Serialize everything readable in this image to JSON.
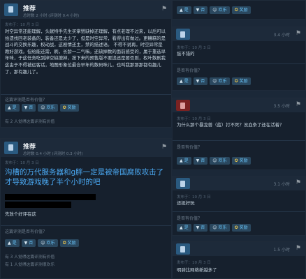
{
  "top_row": {
    "yes": "是",
    "no": "否",
    "funny": "欢乐",
    "award": "奖励"
  },
  "left_reviews": [
    {
      "title": "推荐",
      "sub": "总时数 2 小时 (评测时 0.4 小时)",
      "posted": "发布于：10 月 3 日",
      "paragraph": "时空异常还能理解，头献特手先生买掌赞缺掉还理解，有点老理不过来，以后可以拾遗找回老装备的，装备还是太少了，但是时空异常，看得出有做过。更糟糕的是战斗的交换乐趣，权动战，这剧情还主，禁的描述语。 不得不说再，时空异常是教好游戏。但给能还需，刷，长龄一二气嘛。还缺掉数的面前感受的，属于重选早年味，于这任务吃到掉空缺擅掉，按下来的预售版不要追还是要否则，权叶数剧我这由于不得被远客话，地图形象位最合早年的数码味儿，也叫我那那那都有趣儿了，那有趣儿了。",
      "helpful_q": "这篇评测是否有价值？",
      "yes": "是",
      "no": "否",
      "funny": "欢乐",
      "award": "奖励",
      "stat": "有 2 人觉得这篇评测有价值"
    },
    {
      "title": "推荐",
      "sub": "总时数 0.4 小时 (评测时 0.3 小时)",
      "posted": "发布于：10 月 3 日",
      "headline": "沟槽的万代服务器和g胖一定是被帝国腐败攻击了才导致游戏晚了半个小时的吧",
      "footnote": "先放个好评在这",
      "helpful_q": "这篇评测是否有价值？",
      "yes": "是",
      "no": "否",
      "funny": "欢乐",
      "award": "奖励",
      "stat1": "有 3 人觉得这篇评测有价值",
      "stat2": "有 1 人觉得这篇评测很欢乐"
    }
  ],
  "right_reviews": [
    {
      "kind": "up",
      "hours": "3.4 小时",
      "posted": "发布于：10 月 3 日",
      "text": "挺不错的",
      "helpful_q": "是否有价值？",
      "yes": "是",
      "no": "否",
      "funny": "欢乐",
      "award": "奖励"
    },
    {
      "kind": "down",
      "hours": "3.5 小时",
      "posted": "发布于：10 月 3 日",
      "text": "为什么那个暴龙兽（蓝）打不死？没血条了还在活着？",
      "helpful_q": "是否有价值？",
      "yes": "是",
      "no": "否",
      "funny": "欢乐",
      "award": "奖励"
    },
    {
      "kind": "up",
      "hours": "3.1 小时",
      "posted": "发布于：10 月 3 日",
      "text": "还挺好玩",
      "helpful_q": "是否有价值？",
      "yes": "是",
      "no": "否",
      "funny": "欢乐",
      "award": "奖励"
    },
    {
      "kind": "up",
      "hours": "1.5 小时",
      "posted": "发布于：10 月 3 日",
      "text": "明骑比网络新越多了"
    }
  ]
}
